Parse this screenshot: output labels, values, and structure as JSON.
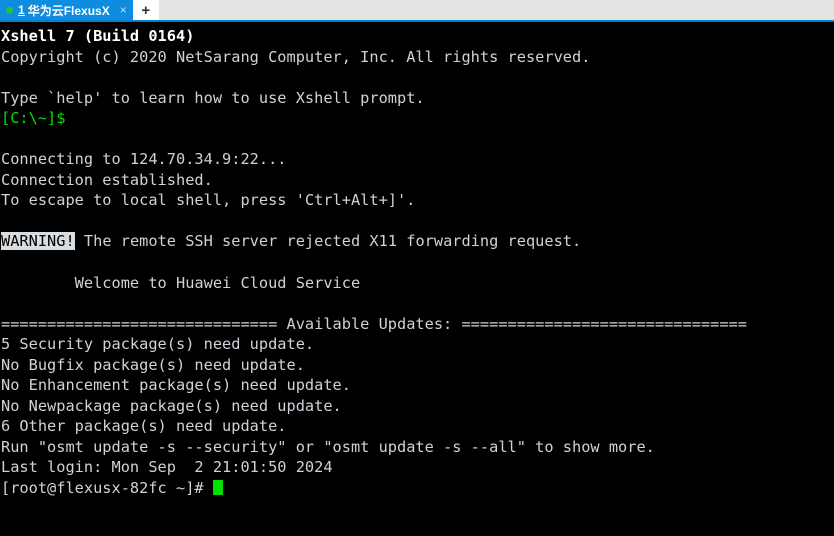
{
  "window": {
    "app": "Xshell 7"
  },
  "tabbar": {
    "tabs": [
      {
        "index": "1",
        "title": "华为云FlexusX",
        "status_dot": "green",
        "close_glyph": "×",
        "active": true
      }
    ],
    "new_tab_glyph": "+"
  },
  "terminal": {
    "lines": [
      {
        "text": "Xshell 7 (Build 0164)",
        "style": "bold-white"
      },
      {
        "text": "Copyright (c) 2020 NetSarang Computer, Inc. All rights reserved.",
        "style": "normal"
      },
      {
        "text": "",
        "style": "normal"
      },
      {
        "text": "Type `help' to learn how to use Xshell prompt.",
        "style": "normal"
      },
      {
        "text": "[C:\\~]$",
        "style": "green"
      },
      {
        "text": "",
        "style": "normal"
      },
      {
        "text": "Connecting to 124.70.34.9:22...",
        "style": "normal"
      },
      {
        "text": "Connection established.",
        "style": "normal"
      },
      {
        "text": "To escape to local shell, press 'Ctrl+Alt+]'.",
        "style": "normal"
      },
      {
        "text": "",
        "style": "normal"
      },
      {
        "text_inverse": "WARNING!",
        "text": " The remote SSH server rejected X11 forwarding request.",
        "style": "warning"
      },
      {
        "text": "",
        "style": "normal"
      },
      {
        "text": "        Welcome to Huawei Cloud Service",
        "style": "normal"
      },
      {
        "text": "",
        "style": "normal"
      },
      {
        "text": "============================== Available Updates: ===============================",
        "style": "normal"
      },
      {
        "text": "5 Security package(s) need update.",
        "style": "normal"
      },
      {
        "text": "No Bugfix package(s) need update.",
        "style": "normal"
      },
      {
        "text": "No Enhancement package(s) need update.",
        "style": "normal"
      },
      {
        "text": "No Newpackage package(s) need update.",
        "style": "normal"
      },
      {
        "text": "6 Other package(s) need update.",
        "style": "normal"
      },
      {
        "text": "Run \"osmt update -s --security\" or \"osmt update -s --all\" to show more.",
        "style": "normal"
      },
      {
        "text": "Last login: Mon Sep  2 21:01:50 2024",
        "style": "normal"
      },
      {
        "text": "[root@flexusx-82fc ~]# ",
        "style": "prompt-cursor"
      }
    ]
  },
  "colors": {
    "tab_active": "#0d8ce0",
    "tab_bar_bg": "#e4e4e4",
    "tab_underline": "#0a7fc7",
    "status_dot": "#22c53b",
    "terminal_bg": "#000000",
    "terminal_fg": "#cdd3d8",
    "prompt_green": "#00e000",
    "cursor_green": "#00e000",
    "inverse_bg": "#d8dde2"
  }
}
